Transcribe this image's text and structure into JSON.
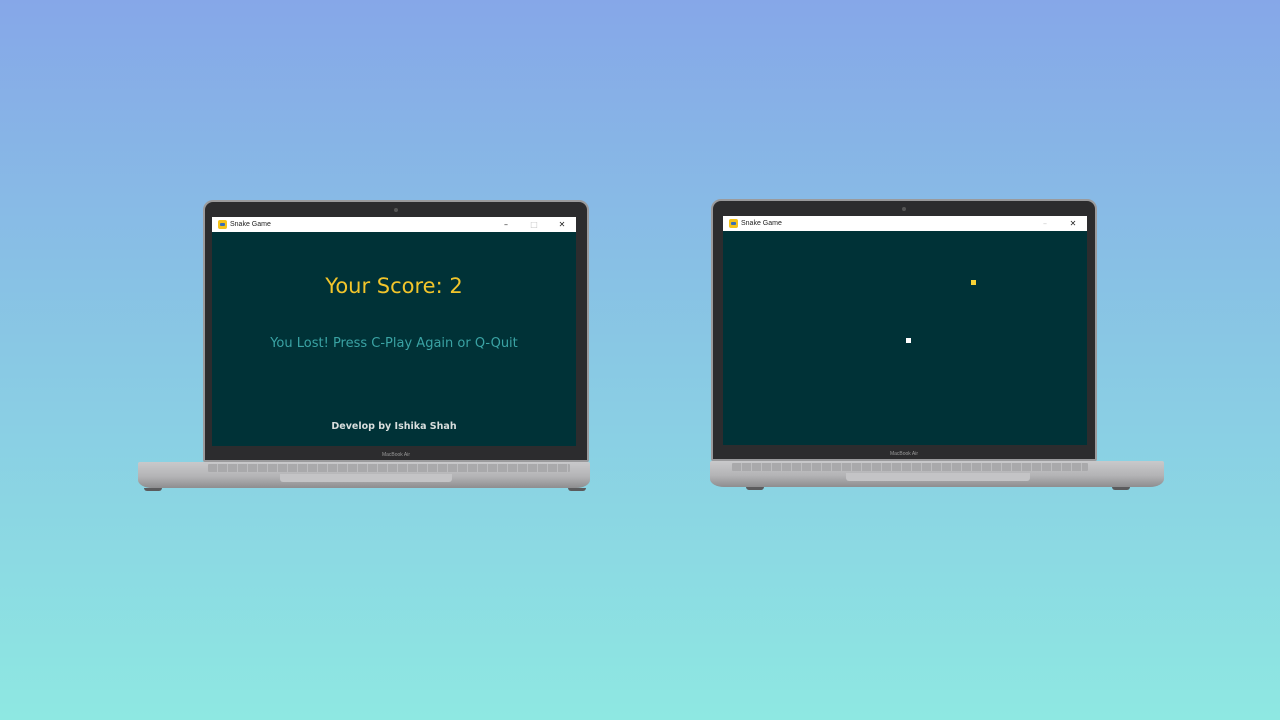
{
  "window": {
    "title": "Snake Game",
    "minimize_icon": "minimize-icon",
    "maximize_icon": "maximize-icon",
    "close_icon": "close-icon",
    "minimize_glyph": "–",
    "maximize_glyph": "□",
    "close_glyph": "✕"
  },
  "laptop": {
    "model_label": "MacBook Air"
  },
  "game_over_screen": {
    "score_label": "Your Score: 2",
    "message": "You Lost! Press C-Play Again or Q-Quit",
    "credit": "Develop by Ishika Shah"
  },
  "playing_screen": {
    "food_icon": "food-square",
    "snake_icon": "snake-head-square"
  },
  "colors": {
    "game_background": "#003237",
    "score_text": "#f2c52b",
    "message_text": "#3aa3a4",
    "food": "#f7d236",
    "snake": "#ffffff"
  }
}
